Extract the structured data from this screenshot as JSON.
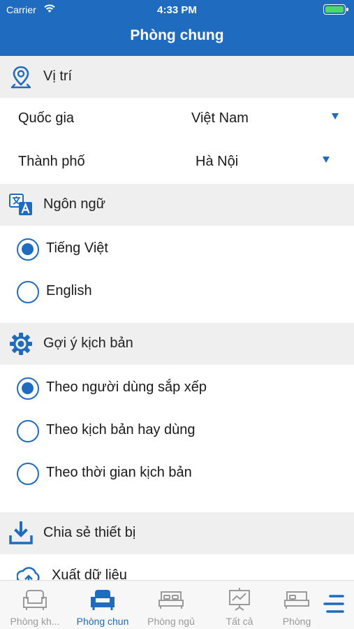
{
  "status_bar": {
    "carrier": "Carrier",
    "time": "4:33 PM"
  },
  "header": {
    "title": "Phòng chung"
  },
  "location": {
    "title": "Vị trí",
    "country_label": "Quốc gia",
    "country_value": "Việt Nam",
    "city_label": "Thành phố",
    "city_value": "Hà Nội"
  },
  "language": {
    "title": "Ngôn ngữ",
    "options": [
      {
        "label": "Tiếng Việt",
        "selected": true
      },
      {
        "label": "English",
        "selected": false
      }
    ]
  },
  "scenario": {
    "title": "Gợi ý kịch bản",
    "options": [
      {
        "label": "Theo người dùng sắp xếp",
        "selected": true
      },
      {
        "label": "Theo kịch bản hay dùng",
        "selected": false
      },
      {
        "label": "Theo thời gian kịch bản",
        "selected": false
      }
    ]
  },
  "share": {
    "title": "Chia sẻ thiết bị",
    "export_label": "Xuất dữ liệu"
  },
  "tabs": [
    {
      "label": "Phòng kh...",
      "active": false
    },
    {
      "label": "Phòng chun",
      "active": true
    },
    {
      "label": "Phòng ngủ",
      "active": false
    },
    {
      "label": "Tất cả",
      "active": false
    },
    {
      "label": "Phòng",
      "active": false
    }
  ],
  "colors": {
    "primary": "#1f6bbf",
    "section_bg": "#efefef",
    "inactive": "#9a9a9a"
  }
}
